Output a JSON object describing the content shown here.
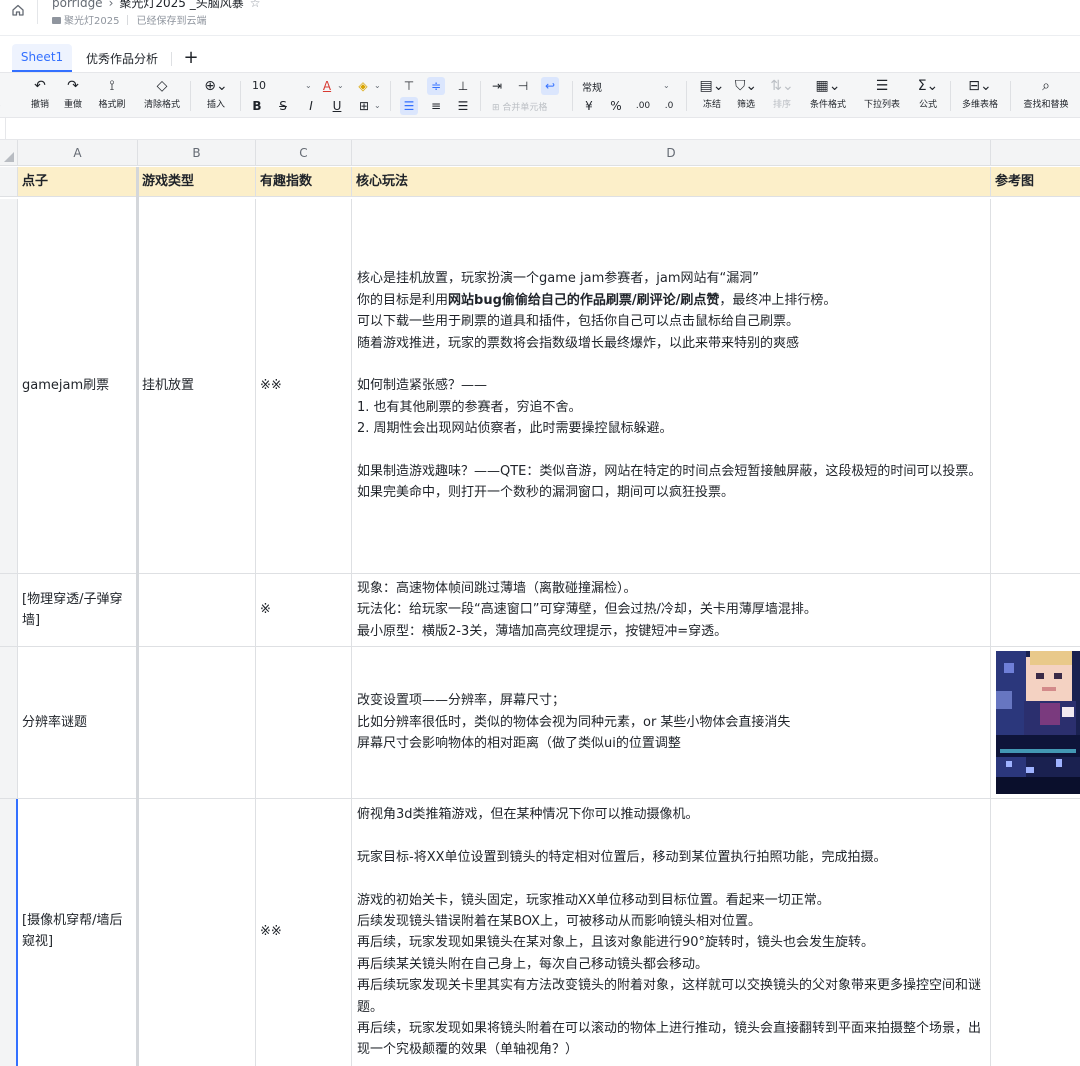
{
  "titlebar": {
    "doc_owner": "porridge",
    "doc_title": "聚光灯2025 _头脑风暴",
    "folder": "聚光灯2025",
    "save_status": "已经保存到云端"
  },
  "tabs": [
    {
      "label": "Sheet1",
      "active": true
    },
    {
      "label": "优秀作品分析",
      "active": false
    }
  ],
  "toolbar": {
    "undo": "撤销",
    "redo": "重做",
    "format_painter": "格式刷",
    "clear_format": "清除格式",
    "insert": "插入",
    "font_size": "10",
    "bold": "B",
    "strike": "S",
    "italic": "I",
    "underline": "U",
    "font_color_letter": "A",
    "merge": "合并单元格",
    "number_format": "常规",
    "currency": "¥",
    "percent": "%",
    "freeze": "冻结",
    "filter": "筛选",
    "sort": "排序",
    "conditional_format": "条件格式",
    "dropdown_list": "下拉列表",
    "formula": "公式",
    "pivot": "多维表格",
    "find_replace": "查找和替换",
    "left_cut": "单"
  },
  "columns": [
    "A",
    "B",
    "C",
    "D"
  ],
  "header_row": {
    "a": "点子",
    "b": "游戏类型",
    "c": "有趣指数",
    "d": "核心玩法",
    "e": "参考图"
  },
  "rows": [
    {
      "idea": "gamejam刷票",
      "type": "挂机放置",
      "fun": "※※",
      "core": [
        "核心是挂机放置，玩家扮演一个game jam参赛者，jam网站有“漏洞”",
        "你的目标是利用网站bug偷偷给自己的作品刷票/刷评论/刷点赞，最终冲上排行榜。",
        "可以下载一些用于刷票的道具和插件，包括你自己可以点击鼠标给自己刷票。",
        "随着游戏推进，玩家的票数将会指数级增长最终爆炸，以此来带来特别的爽感",
        "",
        "如何制造紧张感？——",
        "1. 也有其他刷票的参赛者，穷追不舍。",
        "2. 周期性会出现网站侦察者，此时需要操控鼠标躲避。",
        "",
        "如果制造游戏趣味？——QTE：类似音游，网站在特定的时间点会短暂接触屏蔽，这段极短的时间可以投票。如果完美命中，则打开一个数秒的漏洞窗口，期间可以疯狂投票。"
      ]
    },
    {
      "idea": "[物理穿透/子弹穿墙]",
      "type": "",
      "fun": "※",
      "core": [
        "现象：高速物体帧间跳过薄墙（离散碰撞漏检）。",
        "玩法化：给玩家一段“高速窗口”可穿薄壁，但会过热/冷却，关卡用薄厚墙混排。",
        "最小原型：横版2-3关，薄墙加高亮纹理提示，按键短冲=穿透。"
      ]
    },
    {
      "idea": "分辨率谜题",
      "type": "",
      "fun": "",
      "core": [
        "改变设置项——分辨率，屏幕尺寸；",
        "比如分辨率很低时，类似的物体会视为同种元素，or 某些小物体会直接消失",
        "屏幕尺寸会影响物体的相对距离（做了类似ui的位置调整"
      ]
    },
    {
      "idea": "[摄像机穿帮/墙后窥视]",
      "type": "",
      "fun": "※※",
      "core": [
        "俯视角3d类推箱游戏，但在某种情况下你可以推动摄像机。",
        "",
        "玩家目标-将XX单位设置到镜头的特定相对位置后，移动到某位置执行拍照功能，完成拍摄。",
        "",
        "游戏的初始关卡，镜头固定，玩家推动XX单位移动到目标位置。看起来一切正常。",
        "后续发现镜头错误附着在某BOX上，可被移动从而影响镜头相对位置。",
        "再后续，玩家发现如果镜头在某对象上，且该对象能进行90°旋转时，镜头也会发生旋转。",
        "再后续某关镜头附在自己身上，每次自己移动镜头都会移动。",
        "再后续玩家发现关卡里其实有方法改变镜头的附着对象，这样就可以交换镜头的父对象带来更多操控空间和谜题。",
        "再后续，玩家发现如果将镜头附着在可以滚动的物体上进行推动，镜头会直接翻转到平面来拍摄整个场景，出现一个究极颠覆的效果（单轴视角？）"
      ]
    }
  ]
}
